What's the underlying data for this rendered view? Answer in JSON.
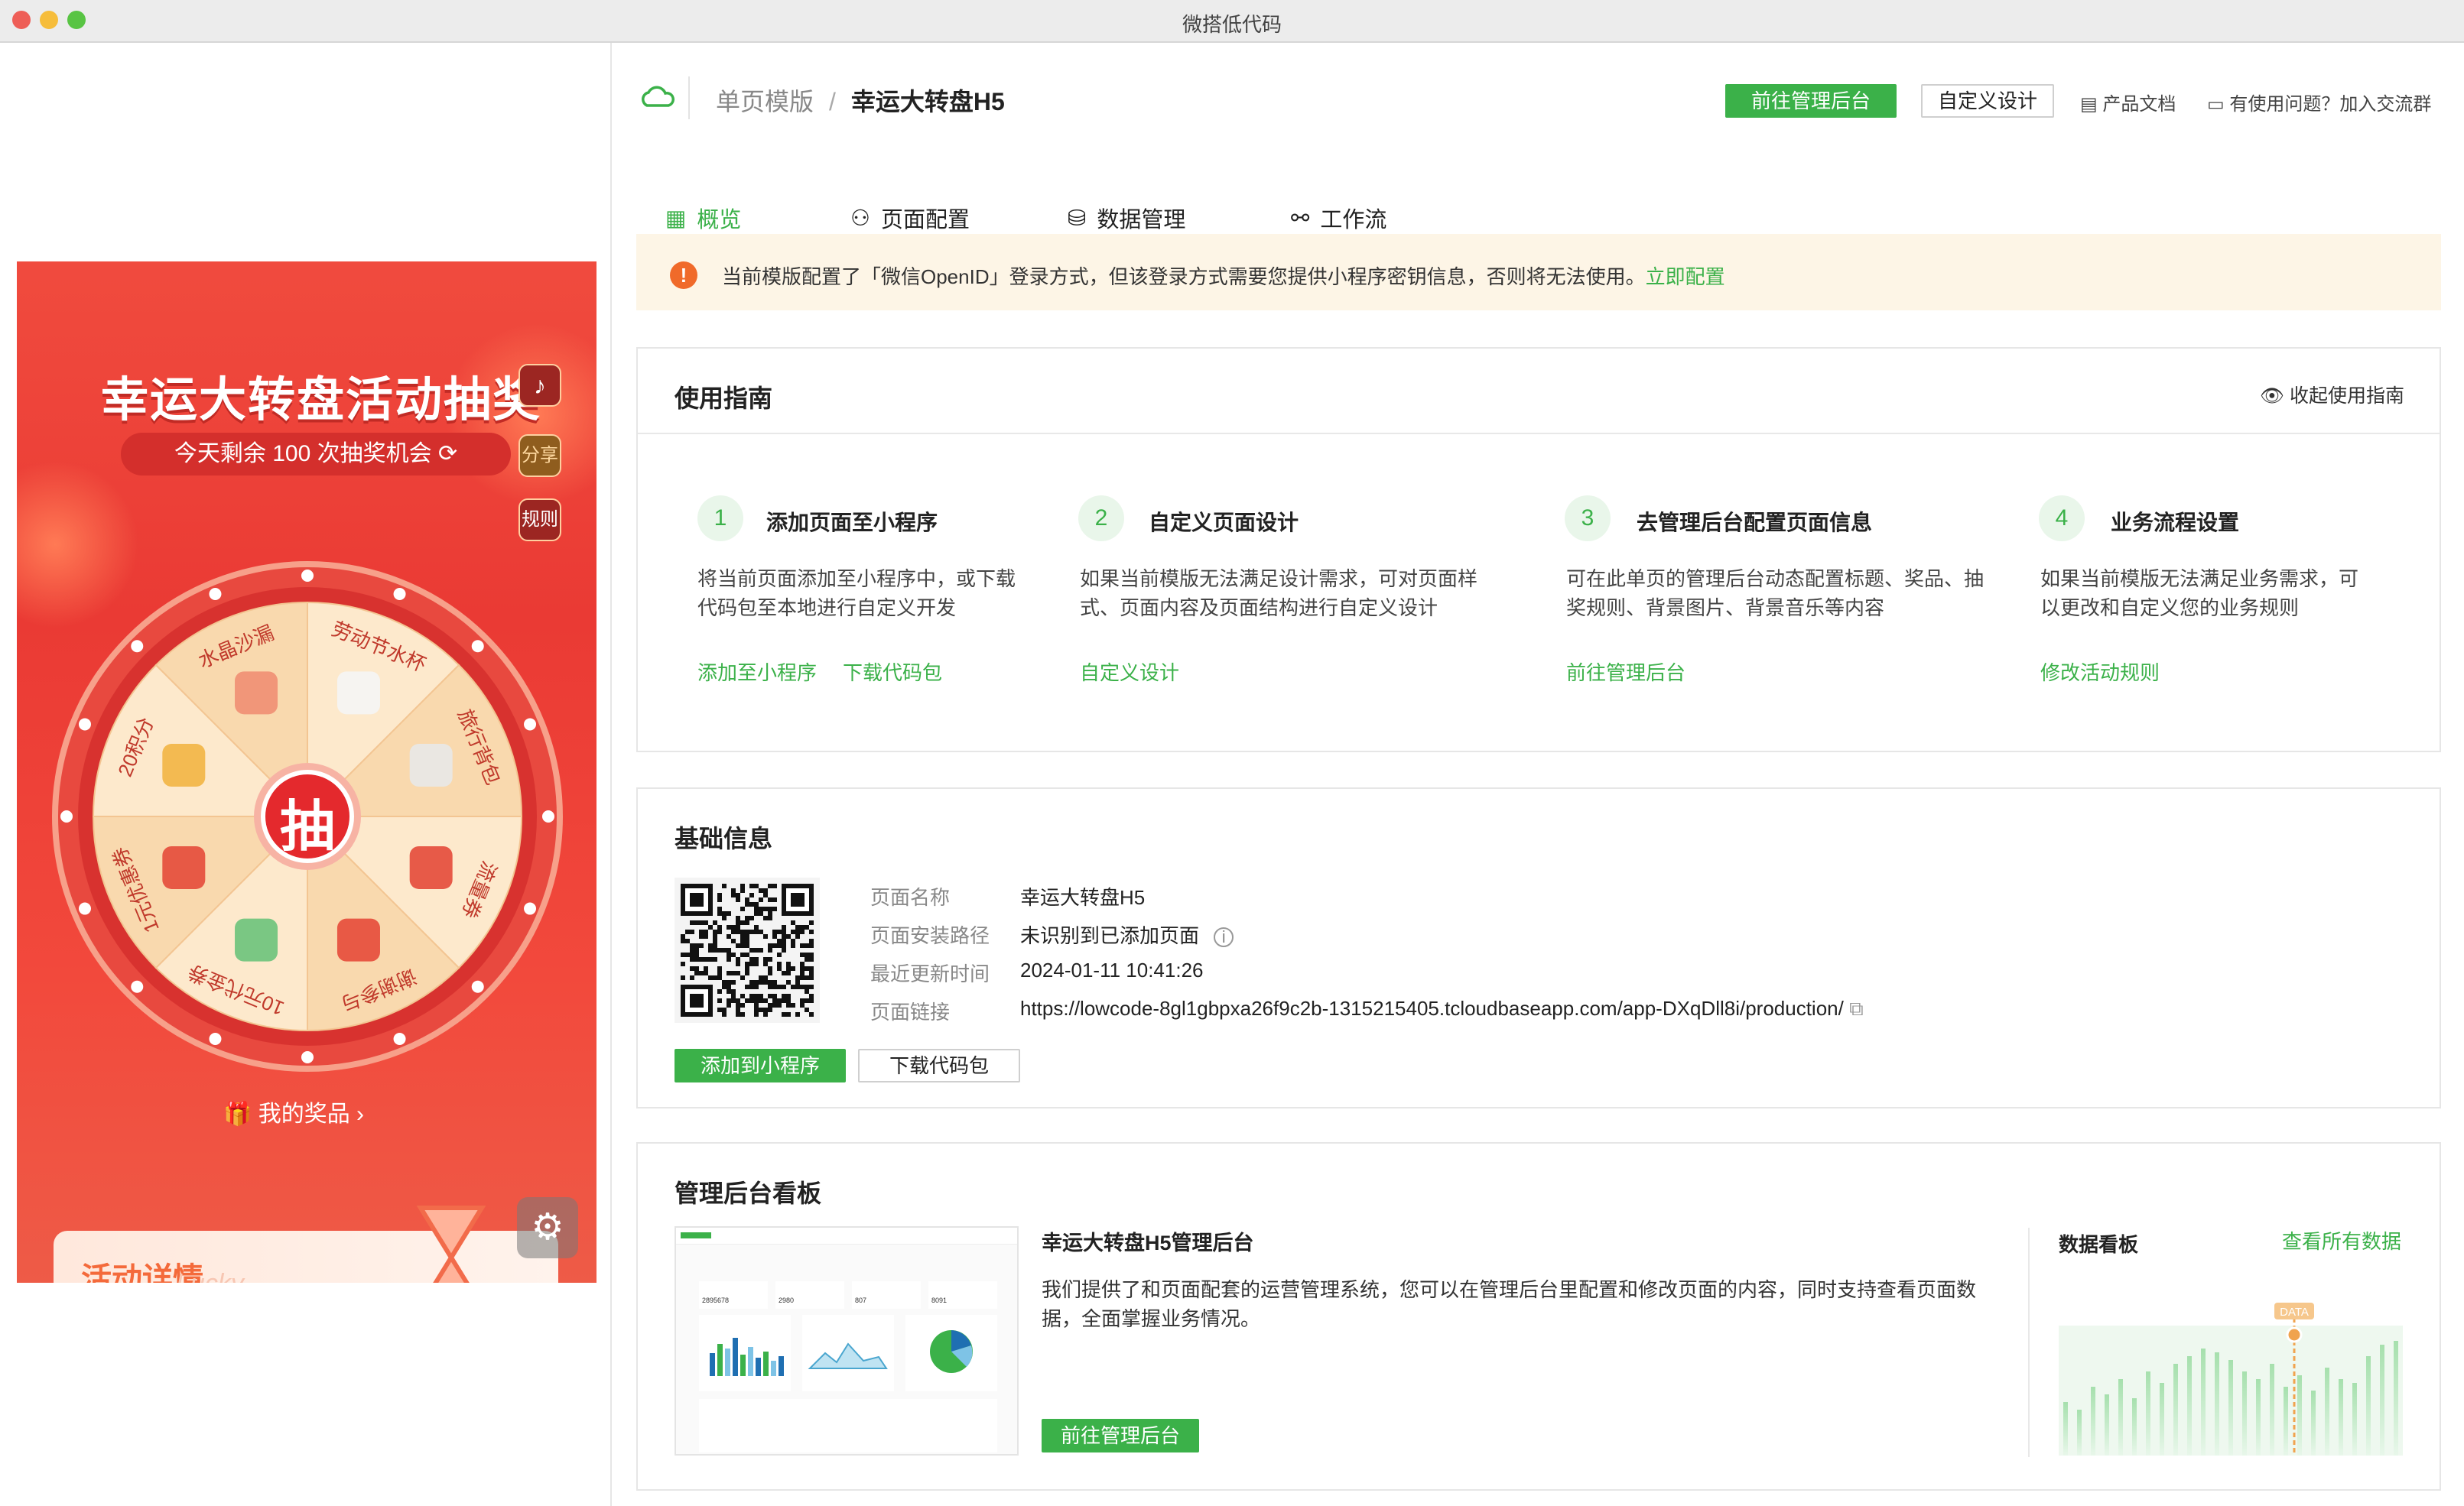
{
  "window": {
    "title": "微搭低代码",
    "close_color": "#ee5e57",
    "min_color": "#f6bd3b",
    "max_color": "#58c443"
  },
  "preview": {
    "title": "幸运大转盘活动抽奖",
    "remaining": "今天剩余 100 次抽奖机会",
    "share": "分享",
    "rules": "规则",
    "draw": "抽",
    "prizes_label": "我的奖品",
    "detail": "活动详情",
    "detail_deco": "Lucky",
    "wheel_items": [
      "劳动节水杯",
      "旅行背包",
      "流量券",
      "谢谢参与",
      "10元代金券",
      "1元优惠券",
      "20积分",
      "水晶沙漏"
    ]
  },
  "header": {
    "breadcrumb_parent": "单页模版",
    "breadcrumb_sep": "/",
    "breadcrumb_current": "幸运大转盘H5",
    "goto_admin": "前往管理后台",
    "custom_design": "自定义设计",
    "docs": "产品文档",
    "help": "有使用问题？加入交流群"
  },
  "tabs": [
    {
      "label": "概览",
      "icon": "grid-icon"
    },
    {
      "label": "页面配置",
      "icon": "user-config-icon"
    },
    {
      "label": "数据管理",
      "icon": "database-icon"
    },
    {
      "label": "工作流",
      "icon": "workflow-icon"
    }
  ],
  "alert": {
    "text": "当前模版配置了「微信OpenID」登录方式，但该登录方式需要您提供小程序密钥信息，否则将无法使用。",
    "link": "立即配置"
  },
  "guide": {
    "title": "使用指南",
    "collapse": "收起使用指南",
    "steps": [
      {
        "num": "1",
        "title": "添加页面至小程序",
        "desc1": "将当前页面添加至小程序中，或下载",
        "desc2": "代码包至本地进行自定义开发",
        "link1": "添加至小程序",
        "link2": "下载代码包"
      },
      {
        "num": "2",
        "title": "自定义页面设计",
        "desc1": "如果当前模版无法满足设计需求，可对页面样",
        "desc2": "式、页面内容及页面结构进行自定义设计",
        "link1": "自定义设计"
      },
      {
        "num": "3",
        "title": "去管理后台配置页面信息",
        "desc1": "可在此单页的管理后台动态配置标题、奖品、抽",
        "desc2": "奖规则、背景图片、背景音乐等内容",
        "link1": "前往管理后台"
      },
      {
        "num": "4",
        "title": "业务流程设置",
        "desc1": "如果当前模版无法满足业务需求，可",
        "desc2": "以更改和自定义您的业务规则",
        "link1": "修改活动规则"
      }
    ]
  },
  "basic": {
    "title": "基础信息",
    "name_label": "页面名称",
    "name_value": "幸运大转盘H5",
    "path_label": "页面安装路径",
    "path_value": "未识别到已添加页面",
    "updated_label": "最近更新时间",
    "updated_value": "2024-01-11 10:41:26",
    "link_label": "页面链接",
    "link_value": "https://lowcode-8gl1gbpxa26f9c2b-1315215405.tcloudbaseapp.com/app-DXqDll8i/production/",
    "add_btn": "添加到小程序",
    "download_btn": "下载代码包"
  },
  "dashboard": {
    "title": "管理后台看板",
    "admin_title": "幸运大转盘H5管理后台",
    "desc1": "我们提供了和页面配套的运营管理系统，您可以在管理后台里配置和修改页面的内容，同时支持查看页面数",
    "desc2": "据，全面掌握业务情况。",
    "goto_admin": "前往管理后台",
    "data_board": "数据看板",
    "view_all": "查看所有数据",
    "data_tag": "DATA",
    "thumb_nums": [
      "2895678",
      "2980",
      "807",
      "8091"
    ]
  },
  "colors": {
    "accent": "#3bb149",
    "warning_bg": "#fdf5e6",
    "warning_icon": "#f06a2a",
    "preview_red": "#ea3a34"
  }
}
